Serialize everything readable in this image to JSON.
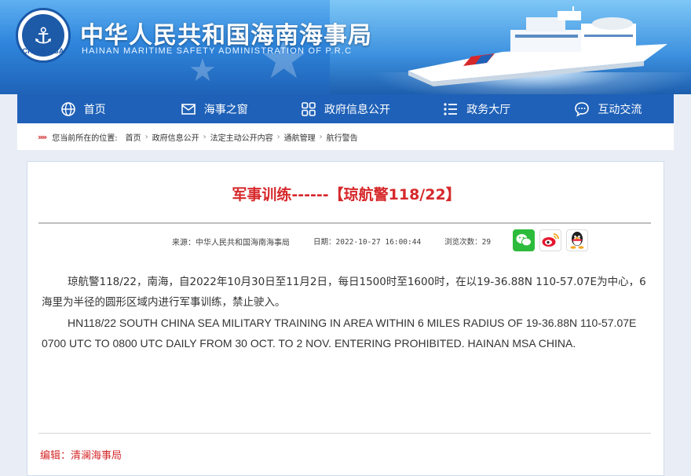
{
  "header": {
    "logo_text": "CHINA MSA",
    "title": "中华人民共和国海南海事局",
    "subtitle": "HAINAN MARITIME SAFETY ADMINISTRATION OF P.R.C"
  },
  "nav": {
    "items": [
      {
        "label": "首页",
        "icon": "globe-icon"
      },
      {
        "label": "海事之窗",
        "icon": "envelope-icon"
      },
      {
        "label": "政府信息公开",
        "icon": "grid-icon"
      },
      {
        "label": "政务大厅",
        "icon": "list-icon"
      },
      {
        "label": "互动交流",
        "icon": "chat-icon"
      }
    ]
  },
  "breadcrumb": {
    "prefix": "您当前所在的位置:",
    "items": [
      "首页",
      "政府信息公开",
      "法定主动公开内容",
      "通航管理",
      "航行警告"
    ]
  },
  "article": {
    "title": "军事训练------【琼航警118/22】",
    "source": "来源：中华人民共和国海南海事局",
    "date": "日期：2022-10-27 16:00:44",
    "views": "浏览次数：29",
    "paragraph_cn": "琼航警118/22，南海，自2022年10月30日至11月2日，每日1500时至1600时，在以19-36.88N 110-57.07E为中心，6海里为半径的圆形区域内进行军事训练，禁止驶入。",
    "paragraph_en": "HN118/22 SOUTH CHINA SEA MILITARY TRAINING IN AREA WITHIN 6 MILES RADIUS OF 19-36.88N 110-57.07E 0700 UTC TO 0800 UTC DAILY FROM 30 OCT. TO 2 NOV. ENTERING PROHIBITED. HAINAN MSA CHINA.",
    "editor": "编辑：清澜海事局"
  },
  "share": [
    "wechat-icon",
    "weibo-icon",
    "qq-icon"
  ],
  "colors": {
    "nav_bg": "#1f61b8",
    "title_red": "#d6282b",
    "banner_blue": "#2f86dc"
  }
}
